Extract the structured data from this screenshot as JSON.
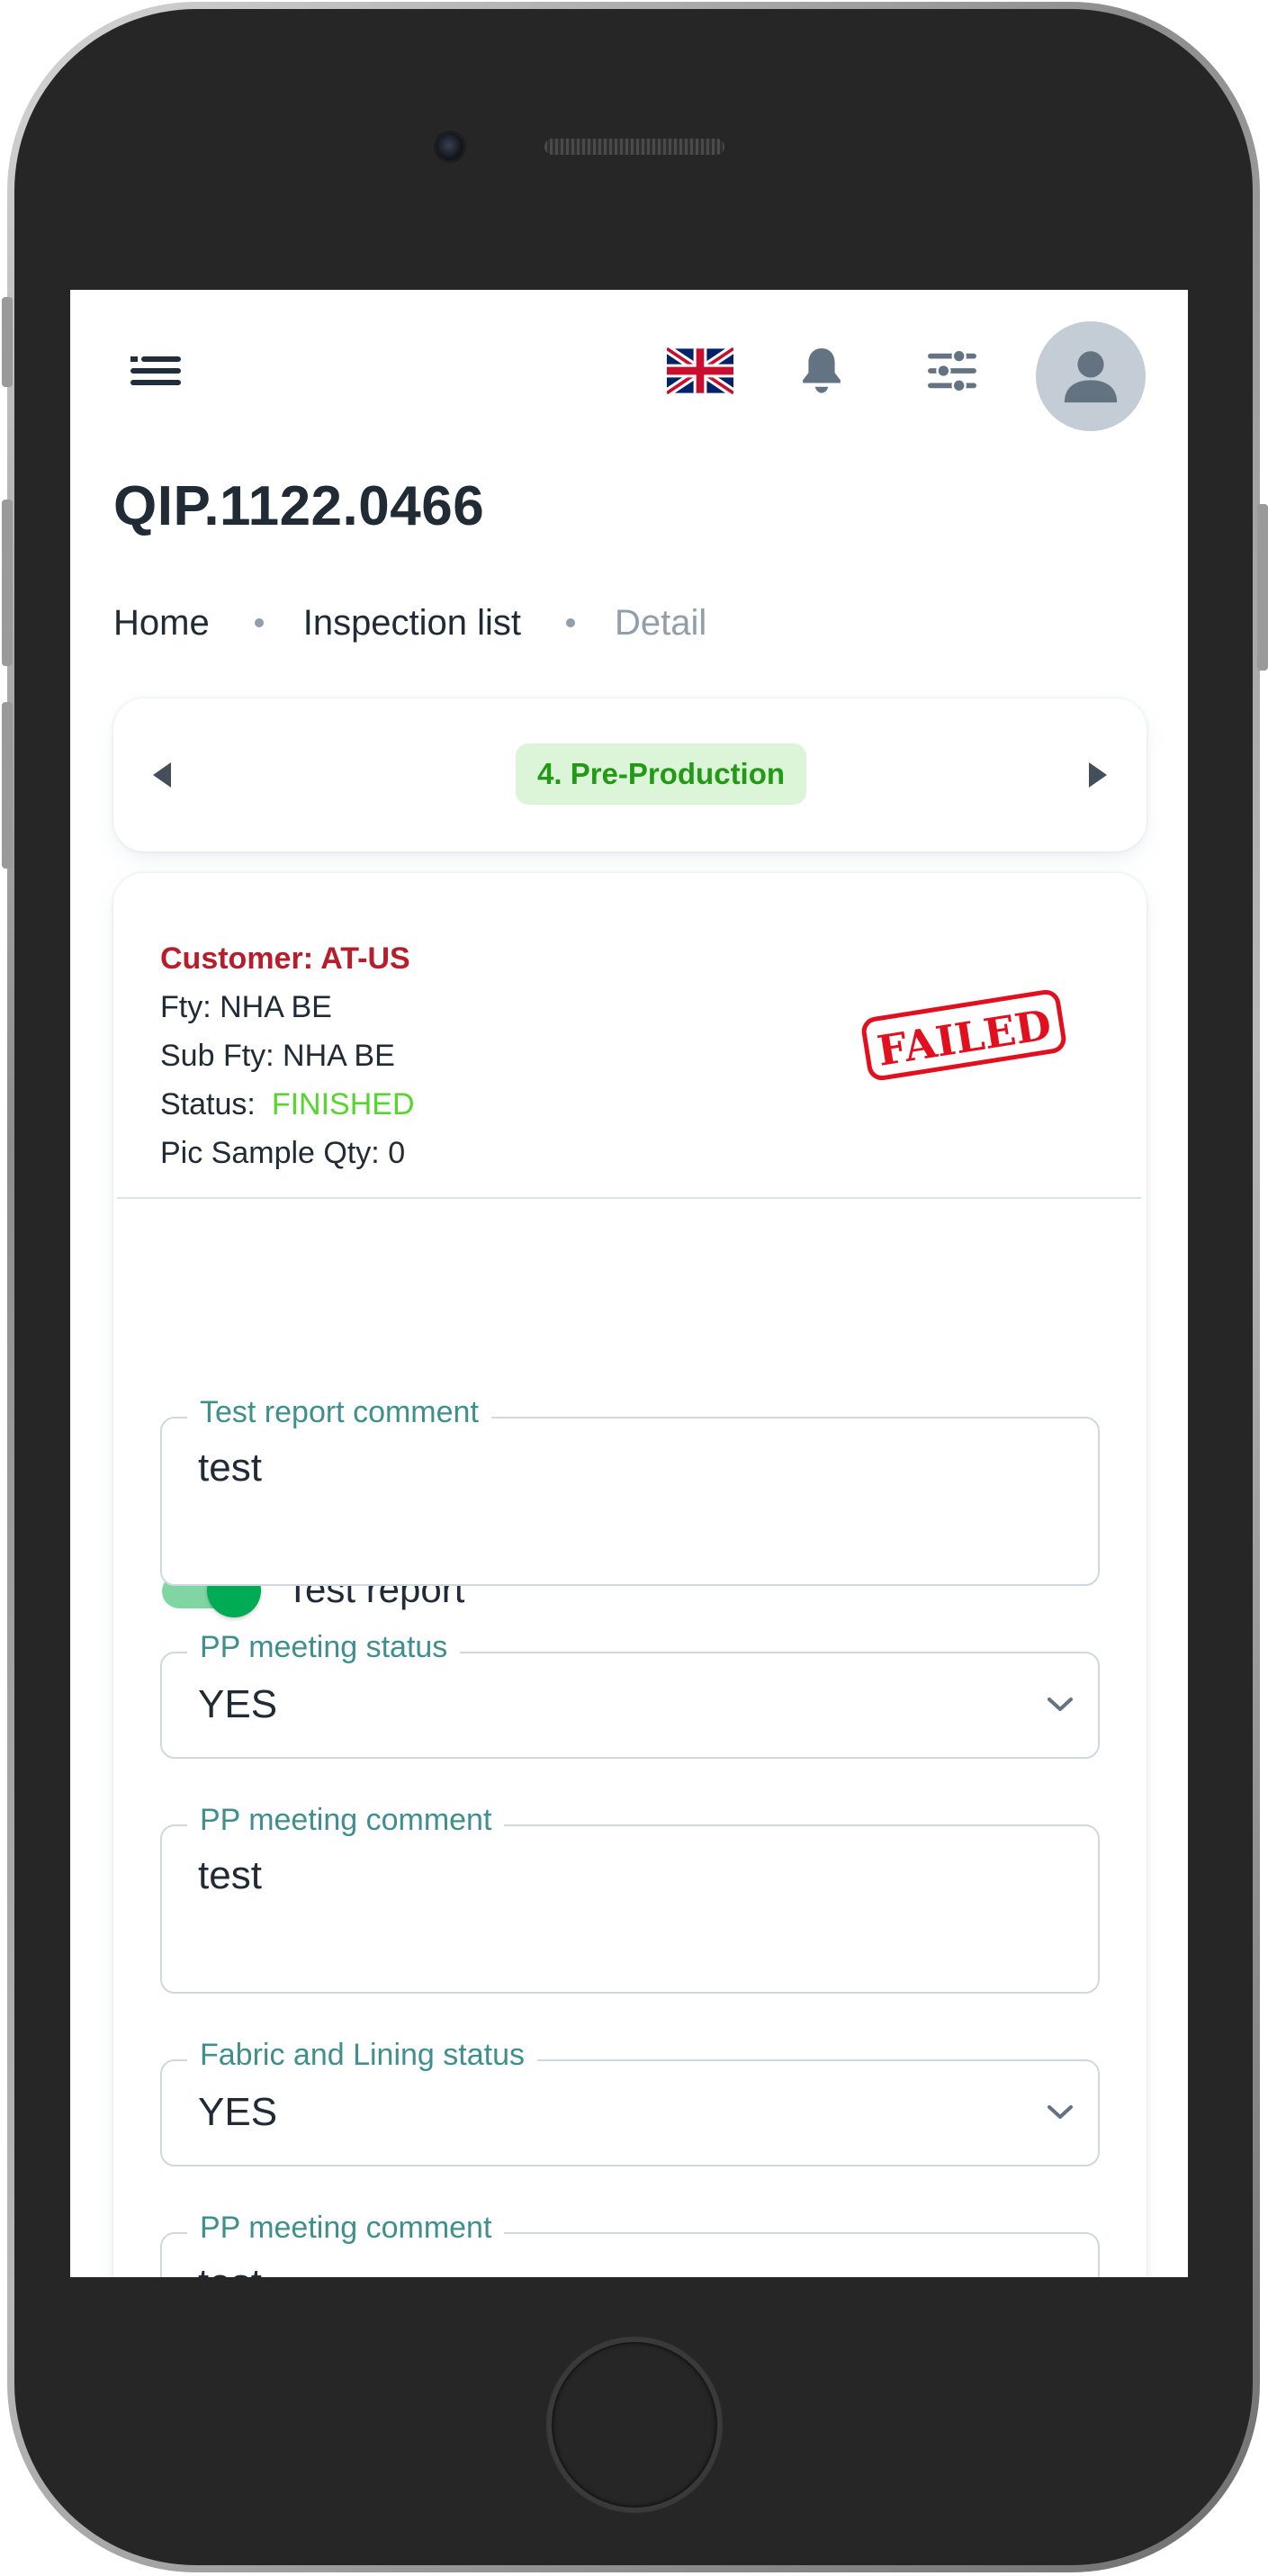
{
  "header": {
    "menu_icon": "menu-icon",
    "language_icon": "uk-flag-icon",
    "notification_icon": "bell-icon",
    "settings_icon": "tune-icon",
    "avatar_icon": "user-icon"
  },
  "page": {
    "title": "QIP.1122.0466",
    "breadcrumb": [
      "Home",
      "Inspection list",
      "Detail"
    ]
  },
  "stage": {
    "label": "4. Pre-Production",
    "prev_icon": "caret-left-icon",
    "next_icon": "caret-right-icon",
    "chip_bg": "#dcf5d8",
    "chip_color": "#229a16"
  },
  "info": {
    "customer": "Customer: AT-US",
    "fty": "Fty: NHA BE",
    "sub_fty": "Sub Fty: NHA BE",
    "status_label": "Status:",
    "status_value": "FINISHED",
    "pic_sample": "Pic Sample Qty: 0",
    "stamp": "FAILED",
    "status_color": "#54d62c",
    "customer_color": "#b71d2a"
  },
  "form": {
    "test_report_toggle": {
      "label": "Test report",
      "on": true
    },
    "test_report_comment": {
      "label": "Test report comment",
      "value": "test"
    },
    "pp_meeting_status": {
      "label": "PP meeting status",
      "value": "YES"
    },
    "pp_meeting_comment": {
      "label": "PP meeting comment",
      "value": "test"
    },
    "fabric_lining_status": {
      "label": "Fabric and Lining status",
      "value": "YES"
    },
    "pp_meeting_comment_2": {
      "label": "PP meeting comment",
      "value": "test"
    }
  },
  "colors": {
    "accent": "#00ab55",
    "field_label": "#3f8f8e",
    "text": "#212b36"
  }
}
